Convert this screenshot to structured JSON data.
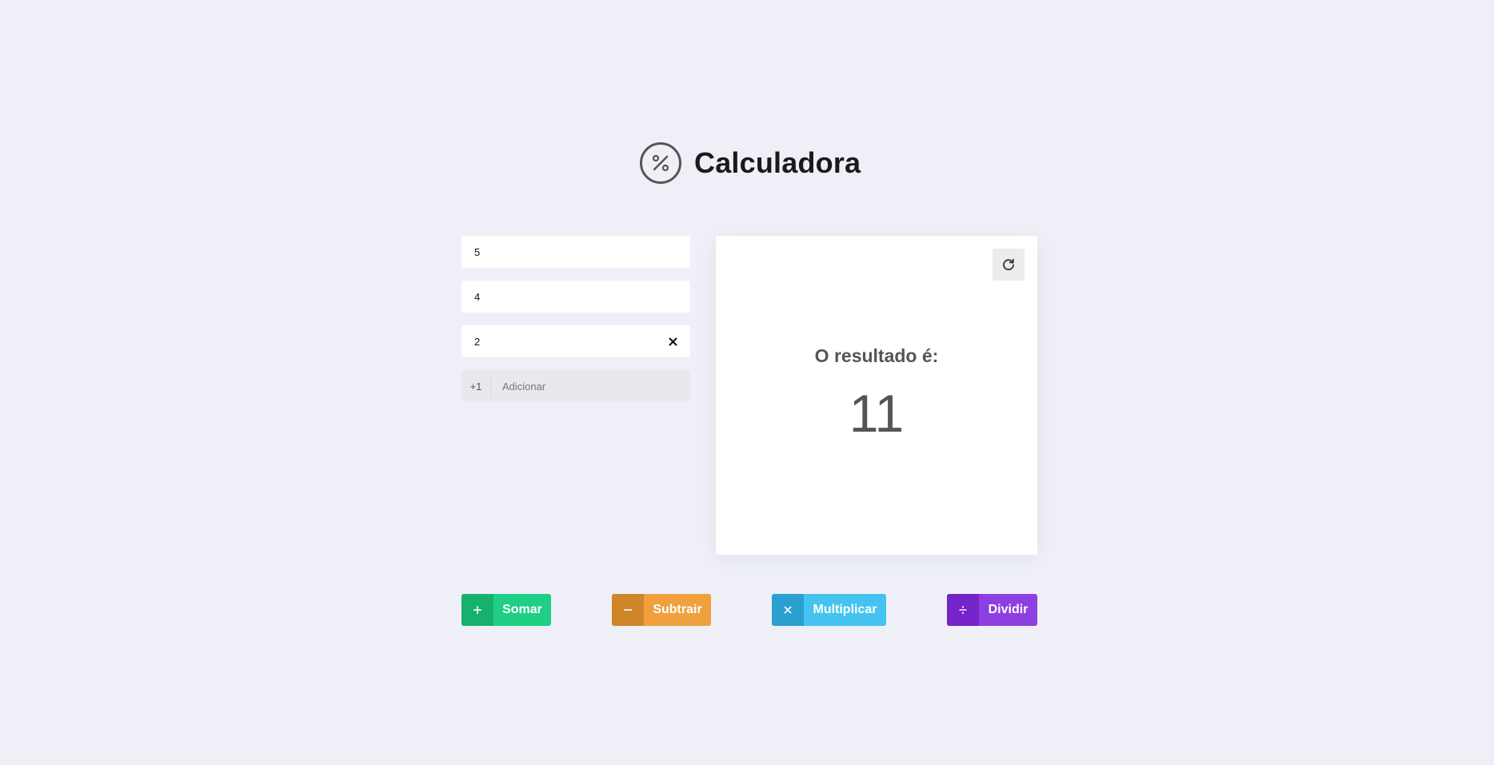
{
  "header": {
    "title": "Calculadora",
    "icon": "percent-icon"
  },
  "inputs": {
    "fields": [
      {
        "value": "5"
      },
      {
        "value": "4"
      },
      {
        "value": "2"
      }
    ],
    "add": {
      "prefix": "+1",
      "label": "Adicionar"
    }
  },
  "result": {
    "label": "O resultado é:",
    "value": "11",
    "reset_icon": "refresh-icon"
  },
  "operations": [
    {
      "label": "Somar",
      "icon": "plus-icon",
      "color": "#1ecf85",
      "icon_color": "#17b06f"
    },
    {
      "label": "Subtrair",
      "icon": "minus-icon",
      "color": "#f0a03c",
      "icon_color": "#cf8629"
    },
    {
      "label": "Multiplicar",
      "icon": "times-icon",
      "color": "#45c3f0",
      "icon_color": "#2a9fd0"
    },
    {
      "label": "Dividir",
      "icon": "divide-icon",
      "color": "#8e3fe0",
      "icon_color": "#7424c8"
    }
  ]
}
